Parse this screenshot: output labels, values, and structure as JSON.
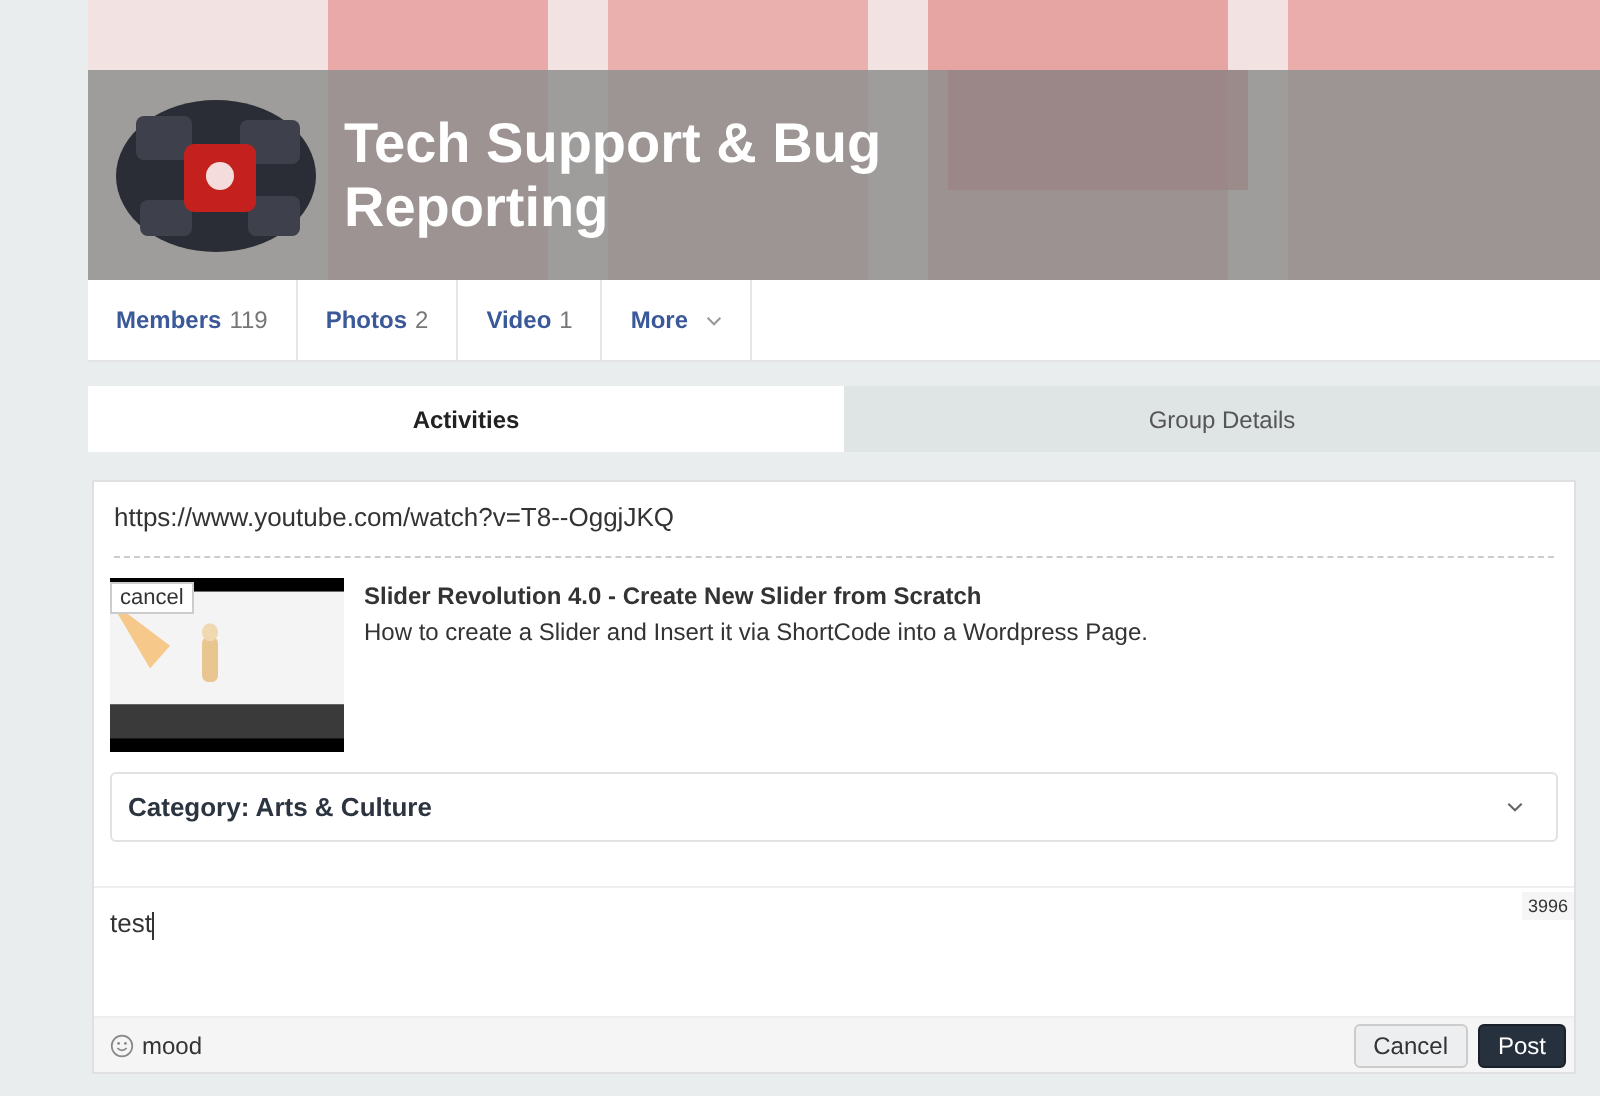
{
  "group": {
    "title": "Tech Support & Bug Reporting"
  },
  "nav": [
    {
      "label": "Members",
      "count": "119",
      "kind": "count"
    },
    {
      "label": "Photos",
      "count": "2",
      "kind": "count"
    },
    {
      "label": "Video",
      "count": "1",
      "kind": "count"
    },
    {
      "label": "More",
      "kind": "menu"
    }
  ],
  "tabs": [
    {
      "label": "Activities",
      "selected": true
    },
    {
      "label": "Group Details",
      "selected": false
    }
  ],
  "composer": {
    "url": "https://www.youtube.com/watch?v=T8--OggjJKQ",
    "preview": {
      "cancel": "cancel",
      "title": "Slider Revolution 4.0 - Create New Slider from Scratch",
      "description": "How to create a Slider and Insert it via ShortCode into a Wordpress Page."
    },
    "category": "Category: Arts & Culture",
    "text": "test",
    "counter": "3996",
    "mood": "mood",
    "buttons": [
      {
        "label": "Cancel",
        "kind": "secondary"
      },
      {
        "label": "Post",
        "kind": "primary"
      }
    ]
  }
}
